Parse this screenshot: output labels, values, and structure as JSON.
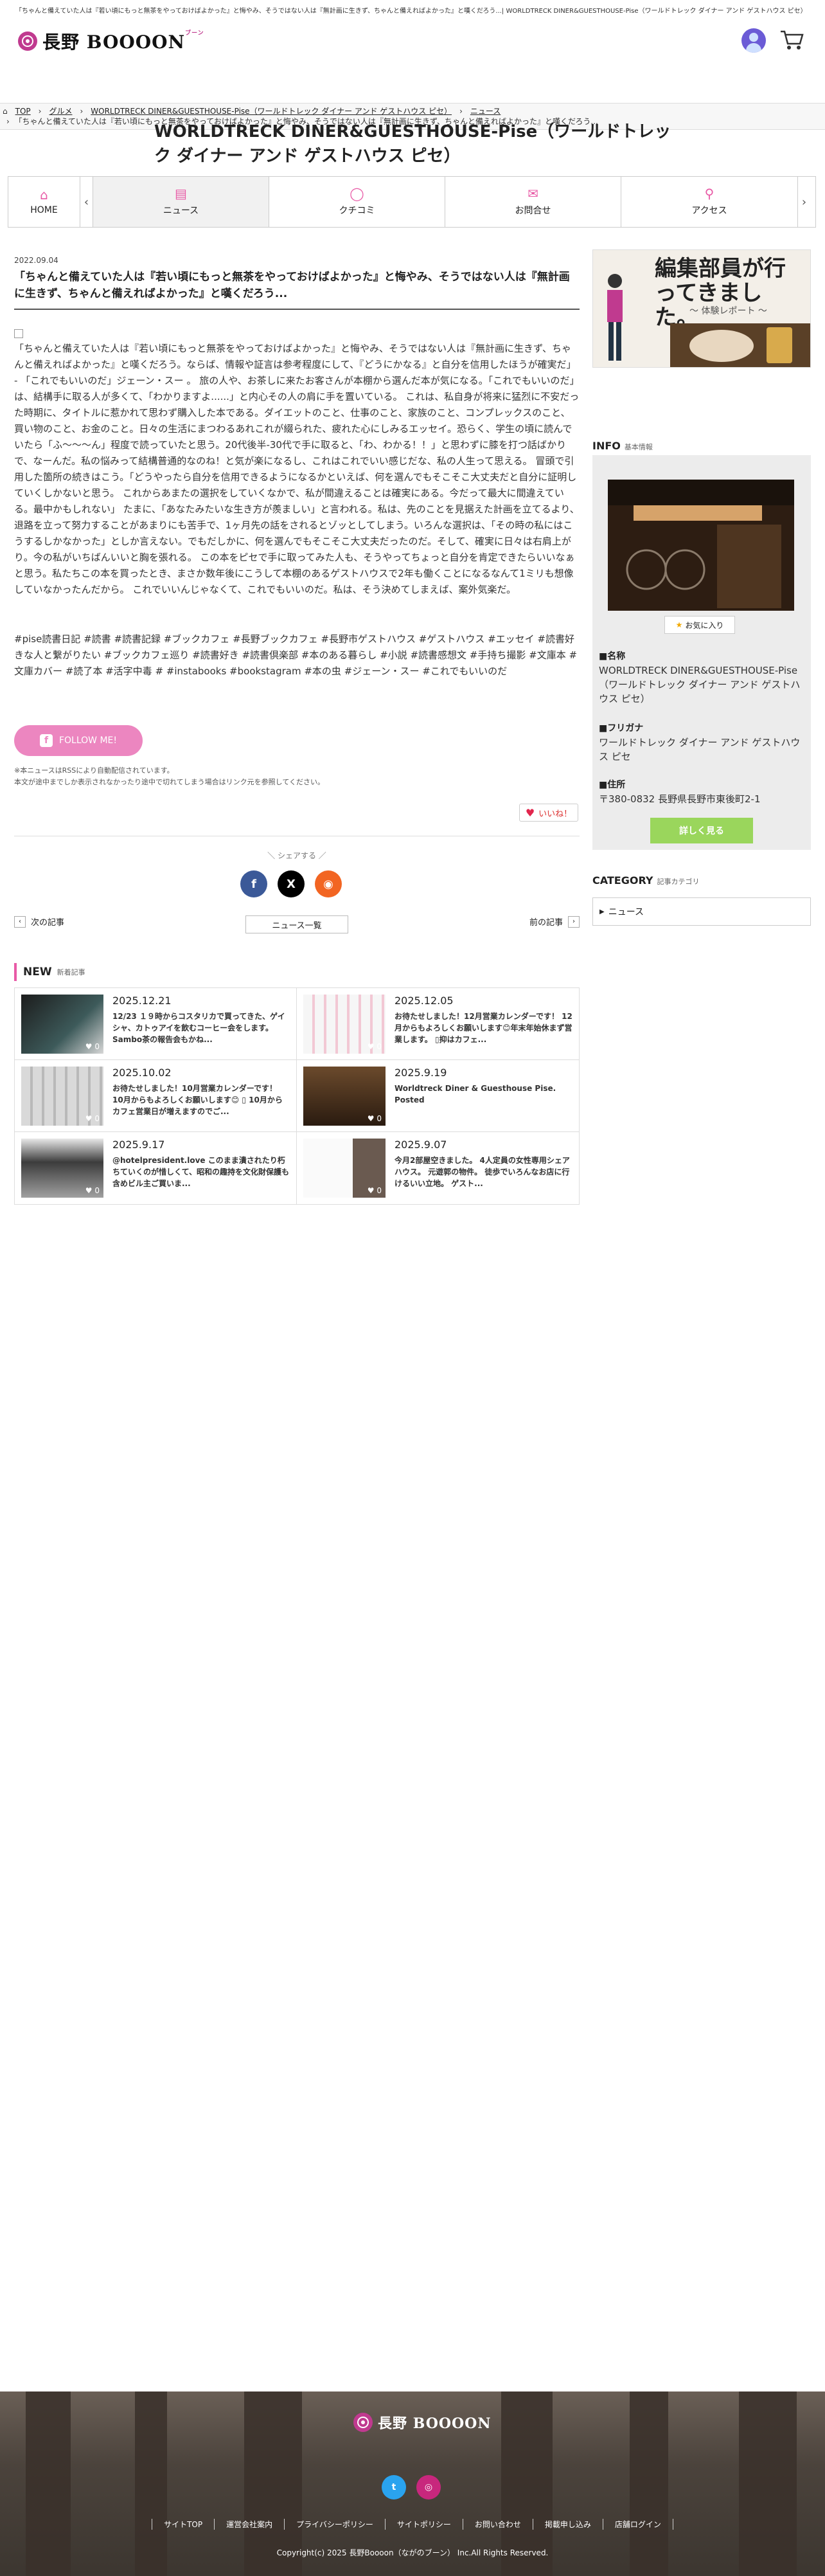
{
  "topbar": {
    "text": "「ちゃんと備えていた人は『若い頃にもっと無茶をやっておけばよかった』と悔やみ、そうではない人は『無計画に生きず、ちゃんと備えればよかった』と嘆くだろう...| WORLDTRECK DINER&GUESTHOUSE-Pise（ワールドトレック ダイナー アンド ゲストハウス ピセ）"
  },
  "header": {
    "logo_text": "長野",
    "logo_brand": "BOOOON",
    "logo_small": "ブーン"
  },
  "breadcrumb": {
    "top": "TOP",
    "gourmet": "グルメ",
    "shop": "WORLDTRECK DINER&GUESTHOUSE-Pise（ワールドトレック ダイナー アンド ゲストハウス ピセ）",
    "news": "ニュース",
    "current": "「ちゃんと備えていた人は『若い頃にもっと無茶をやっておけばよかった』と悔やみ、そうではない人は『無計画に生きず、ちゃんと備えればよかった』と嘆くだろう..."
  },
  "shop_title": "WORLDTRECK DINER&GUESTHOUSE-Pise（ワールドトレック ダイナー アンド ゲストハウス ピセ）",
  "nav": [
    {
      "label": "HOME",
      "icon": "home-icon"
    },
    {
      "label": "ニュース",
      "icon": "news-icon"
    },
    {
      "label": "クチコミ",
      "icon": "comment-icon"
    },
    {
      "label": "お問合せ",
      "icon": "mail-icon"
    },
    {
      "label": "アクセス",
      "icon": "pin-icon"
    }
  ],
  "article": {
    "date": "2022.09.04",
    "title": "「ちゃんと備えていた人は『若い頃にもっと無茶をやっておけばよかった』と悔やみ、そうではない人は『無計画に生きず、ちゃんと備えればよかった』と嘆くだろう...",
    "body": "「ちゃんと備えていた人は『若い頃にもっと無茶をやっておけばよかった』と悔やみ、そうではない人は『無計画に生きず、ちゃんと備えればよかった』と嘆くだろう。ならば、情報や証言は参考程度にして、『どうにかなる』と自分を信用したほうが確実だ」 - 「これでもいいのだ」ジェーン・スー 。 旅の人や、お茶しに来たお客さんが本棚から選んだ本が気になる。「これでもいいのだ」は、結構手に取る人が多くて、「わかりますよ......」と内心その人の肩に手を置いている。 これは、私自身が将来に猛烈に不安だった時期に、タイトルに惹かれて思わず購入した本である。ダイエットのこと、仕事のこと、家族のこと、コンプレックスのこと、買い物のこと、お金のこと。日々の生活にまつわるあれこれが綴られた、疲れた心にしみるエッセイ。恐らく、学生の頃に読んでいたら「ふ〜〜〜ん」程度で読っていたと思う。20代後半-30代で手に取ると、「わ、わかる！！」と思わずに膝を打つ話ばかりで、なーんだ。私の悩みって結構普通的なのね！と気が楽になるし、これはこれでいい感じだな、私の人生って思える。 冒頭で引用した箇所の続きはこう。「どうやったら自分を信用できるようになるかといえば、何を選んでもそこそこ大丈夫だと自分に証明していくしかないと思う。 これからあまたの選択をしていくなかで、私が間違えることは確実にある。今だって最大に間違えている。最中かもしれない」 たまに、「あなたみたいな生き方が羨ましい」と言われる。私は、先のことを見据えた計画を立てるより、退路を立って努力することがあまりにも苦手で、1ヶ月先の話をされるとゾッとしてしまう。いろんな選択は、「その時の私にはこうするしかなかった」としか言えない。でもだしかに、何を選んでもそこそこ大丈夫だったのだ。そして、確実に日々は右肩上がり。今の私がいちばんいいと胸を張れる。 この本をピセで手に取ってみた人も、そうやってちょっと自分を肯定できたらいいなぁと思う。私たちこの本を買ったとき、まさか数年後にこうして本棚のあるゲストハウスで2年も働くことになるなんて1ミリも想像していなかったんだから。 これでいいんじゃなくて、これでもいいのだ。私は、そう決めてしまえば、案外気楽だ。",
    "tags": "#pise読書日記 #読書 #読書記録 #ブックカフェ #長野ブックカフェ #長野市ゲストハウス #ゲストハウス #エッセイ #読書好きな人と繋がりたい #ブックカフェ巡り #読書好き #読書倶楽部 #本のある暮らし #小説 #読書感想文 #手持ち撮影 #文庫本 #文庫カバー #読了本 #活字中毒 # #instabooks #bookstagram #本の虫 #ジェーン・スー #これでもいいのだ",
    "follow_label": "FOLLOW ME!",
    "note1": "※本ニュースはRSSにより自動配信されています。",
    "note2": "本文が途中までしか表示されなかったり途中で切れてしまう場合はリンク元を参照してください。",
    "like_label": "いいね！"
  },
  "share": {
    "label": "＼ シェアする ／"
  },
  "prev_next": {
    "prev": "次の記事",
    "list": "ニュース一覧",
    "next": "前の記事"
  },
  "new_section": {
    "title": "NEW",
    "subtitle": "新着記事",
    "items": [
      {
        "date": "2025.12.21",
        "text": "12/23 １９時からコスタリカで買ってきた、ゲイシャ、カトゥアイを飲むコーヒー会をします。 Sambo茶の報告会もかね..."
      },
      {
        "date": "2025.12.05",
        "text": "お待たせしました！12月営業カレンダーです！ 12月からもよろしくお願いします😊年末年始休まず営業します。 ▯抑はカフェ..."
      },
      {
        "date": "2025.10.02",
        "text": "お待たせしました！10月営業カレンダーです！ 10月からもよろしくお願いします😊 ▯ 10月からカフェ営業日が増えますのでご..."
      },
      {
        "date": "2025.9.19",
        "text": "Worldtreck Diner & Guesthouse Pise. Posted"
      },
      {
        "date": "2025.9.17",
        "text": "@hotelpresident.love このまま潰されたり朽ちていくのが惜しくて、昭和の趣持を文化財保護も含めビル主ご買いま..."
      },
      {
        "date": "2025.9.07",
        "text": "今月2部屋空きました。 4人定員の女性専用シェアハウス。 元遊郭の物件。 徒歩でいろんなお店に行けるいい立地。 ゲスト..."
      }
    ]
  },
  "sidebar": {
    "banner_title": "編集部員が行ってきました。",
    "banner_sub": "〜 体験レポート 〜",
    "info_title": "INFO",
    "info_sub": "基本情報",
    "fav_label": "お気に入り",
    "name_label": "■名称",
    "name_value": "WORLDTRECK DINER&GUESTHOUSE-Pise（ワールドトレック ダイナー アンド ゲストハウス ピセ）",
    "furigana_label": "■フリガナ",
    "furigana_value": "ワールドトレック ダイナー アンド ゲストハウス ピセ",
    "address_label": "■住所",
    "address_value": "〒380-0832 長野県長野市東後町2-1",
    "detail_label": "詳しく見る",
    "category_title": "CATEGORY",
    "category_sub": "記事カテゴリ",
    "category_item": "ニュース"
  },
  "footer": {
    "logo_text": "長野",
    "logo_brand": "BOOOON",
    "links": [
      "サイトTOP",
      "運営会社案内",
      "プライバシーポリシー",
      "サイトポリシー",
      "お問い合わせ",
      "掲載申し込み",
      "店舗ログイン"
    ],
    "copyright": "Copyright(c) 2025 長野Boooon（ながのブーン） Inc.All Rights Reserved."
  }
}
